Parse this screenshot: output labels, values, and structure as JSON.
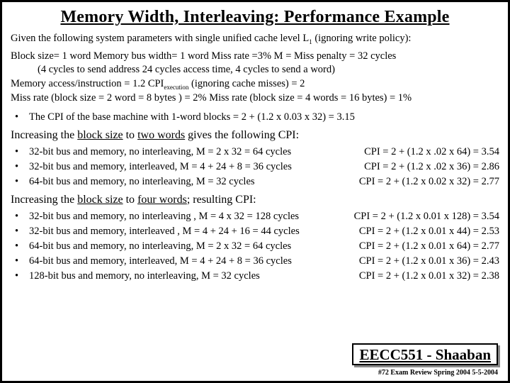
{
  "title": "Memory Width, Interleaving: Performance Example",
  "intro_pre": "Given the following system parameters with single unified cache level L",
  "intro_sub": "1",
  "intro_post": " (ignoring write policy):",
  "params": {
    "l1": "Block size= 1 word   Memory bus width= 1  word    Miss rate =3%    M = Miss penalty = 32 cycles",
    "l1b": "(4 cycles to send address     24 cycles  access time,    4 cycles to send a word)",
    "l2a": "Memory access/instruction = 1.2        CPI",
    "l2sub": "execution",
    "l2b": " (ignoring cache misses) = 2",
    "l3": "Miss rate  (block size = 2 word = 8 bytes ) =  2%     Miss rate  (block size = 4 words = 16 bytes) = 1%"
  },
  "base_cpi": "The CPI of the base machine with 1-word blocks  =  2 + (1.2  x 0.03 x 32) = 3.15",
  "sec2_a": "Increasing the ",
  "sec2_b": "block size",
  "sec2_c": " to ",
  "sec2_d": "two words",
  "sec2_e": " gives the following CPI:",
  "two_words": [
    {
      "left": "32-bit bus and memory, no interleaving,    M = 2 x 32 = 64 cycles",
      "right": "CPI = 2 + (1.2 x  .02 x 64) = 3.54"
    },
    {
      "left": "32-bit bus and memory, interleaved,    M = 4 + 24 + 8  = 36 cycles",
      "right": "CPI = 2 + (1.2 x .02 x 36)  = 2.86"
    },
    {
      "left": "64-bit bus and memory, no interleaving,     M = 32 cycles",
      "right": "CPI = 2 + (1.2 x 0.02 x 32) = 2.77"
    }
  ],
  "sec4_a": "Increasing the ",
  "sec4_b": "block size",
  "sec4_c": " to ",
  "sec4_d": "four words",
  "sec4_e": "; resulting CPI:",
  "four_words": [
    {
      "left": "32-bit bus and memory, no interleaving ,   M = 4 x 32 = 128 cycles",
      "right": "CPI = 2 + (1.2 x 0.01 x 128) = 3.54"
    },
    {
      "left": "32-bit bus and memory, interleaved ,   M = 4 + 24 + 16 = 44 cycles",
      "right": "CPI = 2 + (1.2 x 0.01 x 44)  = 2.53"
    },
    {
      "left": "64-bit bus and memory, no interleaving,    M = 2 x 32 =  64 cycles",
      "right": "CPI = 2 + (1.2 x 0.01 x 64) = 2.77"
    },
    {
      "left": "64-bit bus and memory, interleaved,     M = 4 + 24 + 8 =  36 cycles",
      "right": "CPI = 2 + (1.2 x 0.01 x 36) = 2.43"
    },
    {
      "left": "128-bit bus and memory, no interleaving,     M =  32 cycles",
      "right": "CPI = 2 + (1.2 x 0.01 x 32) = 2.38"
    }
  ],
  "footer_box": "EECC551 - Shaaban",
  "footer_small": "#72  Exam Review  Spring 2004  5-5-2004"
}
